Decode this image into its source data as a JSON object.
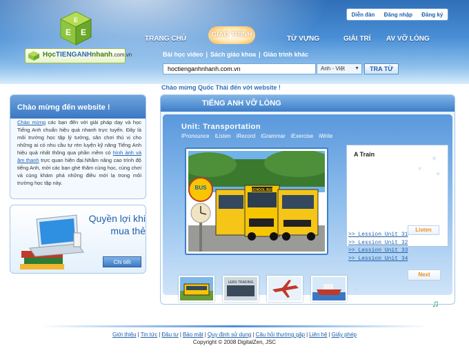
{
  "logo": {
    "part1": "Học",
    "part2": "TIENGANH",
    "part3": "nhanh",
    "part4": ".com.vn",
    "cube_letters": [
      "E",
      "E",
      "E"
    ]
  },
  "top_links": [
    "Diễn đàn",
    "Đăng nhập",
    "Đăng ký"
  ],
  "nav": {
    "items": [
      "TRANG CHỦ",
      "GIÁO TRÌNH",
      "TỪ VỰNG",
      "GIẢI TRÍ",
      "AV VỠ LÒNG"
    ],
    "active": "GIÁO TRÌNH"
  },
  "subnav": {
    "items": [
      "Bài học video",
      "Sách giáo khoa",
      "Giáo trình khác"
    ],
    "separator": "|"
  },
  "search": {
    "value": "hoctienganhnhanh.com.vn",
    "lang": "Anh - Việt",
    "button": "TRA TỪ"
  },
  "welcome_user": "Chào mừng Quốc Thái đến với website !",
  "left_panel": {
    "title": "Chào mừng đến website !",
    "body_parts": [
      "Chào mừng",
      " các bạn đến với giải pháp dạy và học Tiếng Anh chuẩn hiệu quả nhanh trực tuyến. Đây là môi trường học tập lý tưởng, sân chơi thú vị cho những ai có nhu cầu tự rèn luyện kỹ năng Tiếng Anh hiệu quả nhất thông qua phần mềm có ",
      "hình ảnh và âm thanh",
      " trực quan hiện đại.Nhằm nâng cao trình độ tiếng Anh, mời các bạn ghé thăm cùng học, cùng chơi và cùng khám phá những điều mới lạ trong môi trường học tập này."
    ]
  },
  "promo": {
    "title_line1": "Quyền lợi khi",
    "title_line2": "mua thẻ",
    "button": "Chi tiết"
  },
  "main": {
    "section_title": "TIẾNG ANH VỠ LÒNG",
    "unit_title": "Unit: Transportation",
    "tabs": [
      "iPronounce",
      "iListen",
      "iRecord",
      "iGrammar",
      "iExercise",
      "iWrite"
    ],
    "photo_sign": "BUS",
    "bus_sign": "SCHOOL BUS",
    "word": "A Train",
    "listen_button": "Listen",
    "lessons": [
      ">> Lession Unit 31",
      ">> Lession Unit 32",
      ">> Lession Unit 33",
      ">> Lession Unit 34"
    ],
    "next_button": "Next",
    "thumbnail_names": [
      "bus",
      "train",
      "airplane",
      "ship"
    ],
    "thumbnail_label": "LERS TRADING"
  },
  "footer": {
    "links": [
      "Giới thiệu",
      "Tin tức",
      "Đầu tư",
      "Bảo mật",
      "Quy định sử dụng",
      "Câu hỏi thường gặp",
      "Liên hệ",
      "Giấy phép"
    ],
    "copyright": "Copyright © 2008 DigitalZen, JSC"
  },
  "colors": {
    "accent": "#1d5fae",
    "header": "#3a78c4",
    "highlight": "#f08a1a",
    "logo_green": "#8dc63f"
  }
}
